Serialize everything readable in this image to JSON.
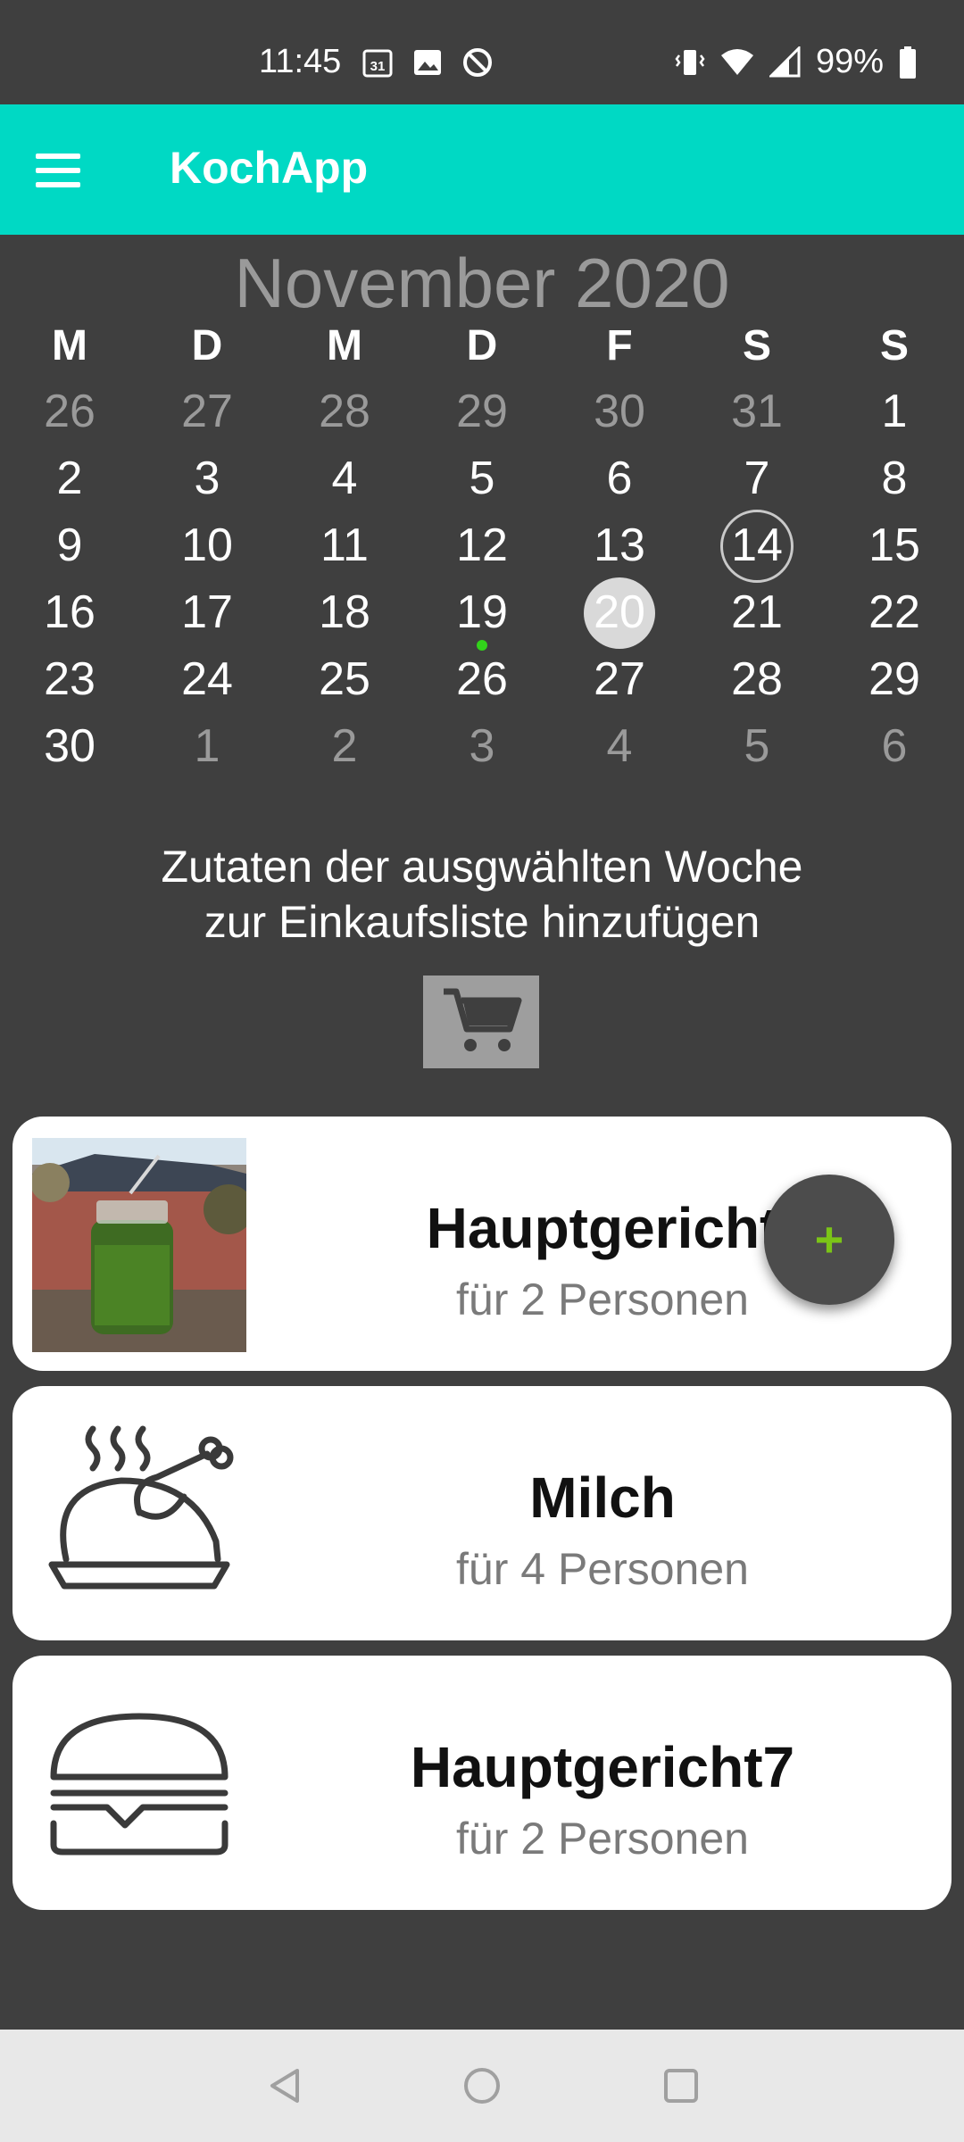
{
  "status_bar": {
    "time": "11:45",
    "battery": "99%",
    "icons_left": [
      "calendar-31-icon",
      "image-icon",
      "do-not-disturb-icon"
    ],
    "icons_right": [
      "vibrate-icon",
      "wifi-icon",
      "signal-icon",
      "battery-icon"
    ]
  },
  "app_bar": {
    "title": "KochApp",
    "color": "#00d9c4"
  },
  "calendar": {
    "month_title": "November 2020",
    "weekday_headers": [
      "M",
      "D",
      "M",
      "D",
      "F",
      "S",
      "S"
    ],
    "weeks": [
      [
        {
          "d": "26",
          "muted": true
        },
        {
          "d": "27",
          "muted": true
        },
        {
          "d": "28",
          "muted": true
        },
        {
          "d": "29",
          "muted": true
        },
        {
          "d": "30",
          "muted": true
        },
        {
          "d": "31",
          "muted": true
        },
        {
          "d": "1",
          "muted": false
        }
      ],
      [
        {
          "d": "2",
          "muted": false
        },
        {
          "d": "3",
          "muted": false
        },
        {
          "d": "4",
          "muted": false
        },
        {
          "d": "5",
          "muted": false
        },
        {
          "d": "6",
          "muted": false
        },
        {
          "d": "7",
          "muted": false
        },
        {
          "d": "8",
          "muted": false
        }
      ],
      [
        {
          "d": "9",
          "muted": false
        },
        {
          "d": "10",
          "muted": false
        },
        {
          "d": "11",
          "muted": false
        },
        {
          "d": "12",
          "muted": false
        },
        {
          "d": "13",
          "muted": false
        },
        {
          "d": "14",
          "muted": false,
          "today": true
        },
        {
          "d": "15",
          "muted": false
        }
      ],
      [
        {
          "d": "16",
          "muted": false
        },
        {
          "d": "17",
          "muted": false
        },
        {
          "d": "18",
          "muted": false
        },
        {
          "d": "19",
          "muted": false,
          "event": true
        },
        {
          "d": "20",
          "muted": false,
          "selected": true
        },
        {
          "d": "21",
          "muted": false
        },
        {
          "d": "22",
          "muted": false
        }
      ],
      [
        {
          "d": "23",
          "muted": false
        },
        {
          "d": "24",
          "muted": false
        },
        {
          "d": "25",
          "muted": false
        },
        {
          "d": "26",
          "muted": false
        },
        {
          "d": "27",
          "muted": false
        },
        {
          "d": "28",
          "muted": false
        },
        {
          "d": "29",
          "muted": false
        }
      ],
      [
        {
          "d": "30",
          "muted": false
        },
        {
          "d": "1",
          "muted": true
        },
        {
          "d": "2",
          "muted": true
        },
        {
          "d": "3",
          "muted": true
        },
        {
          "d": "4",
          "muted": true
        },
        {
          "d": "5",
          "muted": true
        },
        {
          "d": "6",
          "muted": true
        }
      ]
    ],
    "event_dot_color": "#32d21b"
  },
  "shopping": {
    "info_line1": "Zutaten der ausgwählten Woche",
    "info_line2": "zur Einkaufsliste hinzufügen",
    "cart_icon": "shopping-cart-icon"
  },
  "meals": [
    {
      "title": "Hauptgericht",
      "subtitle": "für 2 Personen",
      "image": "green-smoothie-photo"
    },
    {
      "title": "Milch",
      "subtitle": "für 4 Personen",
      "image": "roast-chicken-icon"
    },
    {
      "title": "Hauptgericht7",
      "subtitle": "für 2 Personen",
      "image": "burger-icon"
    }
  ],
  "fab": {
    "symbol": "+",
    "color": "#7bc417"
  },
  "nav_bar": {
    "buttons": [
      "back-icon",
      "home-icon",
      "recents-icon"
    ]
  }
}
